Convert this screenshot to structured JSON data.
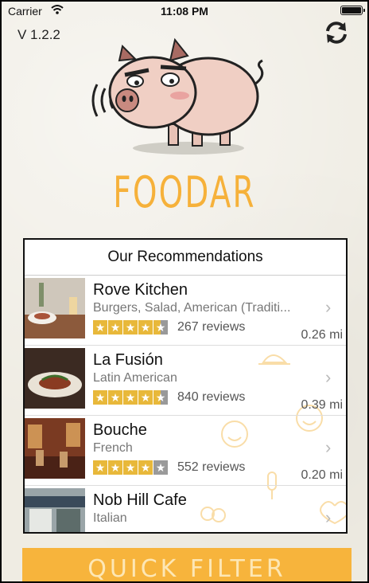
{
  "status_bar": {
    "carrier": "Carrier",
    "time": "11:08 PM"
  },
  "header": {
    "version": "V 1.2.2",
    "brand": "FOODAR",
    "refresh_icon": "refresh-icon"
  },
  "recommendations": {
    "title": "Our Recommendations",
    "items": [
      {
        "name": "Rove Kitchen",
        "category": "Burgers, Salad, American (Traditi...",
        "rating": 4.5,
        "reviews": "267 reviews",
        "distance": "0.26 mi"
      },
      {
        "name": "La Fusión",
        "category": "Latin American",
        "rating": 4.5,
        "reviews": "840 reviews",
        "distance": "0.39 mi"
      },
      {
        "name": "Bouche",
        "category": "French",
        "rating": 4,
        "reviews": "552 reviews",
        "distance": "0.20 mi"
      },
      {
        "name": "Nob Hill Cafe",
        "category": "Italian",
        "rating": null,
        "reviews": "",
        "distance": ""
      }
    ]
  },
  "quick_filter": {
    "label": "QUICK FILTER"
  },
  "colors": {
    "accent": "#f7b43c",
    "background": "#efece3",
    "star": "#e8b83a"
  }
}
